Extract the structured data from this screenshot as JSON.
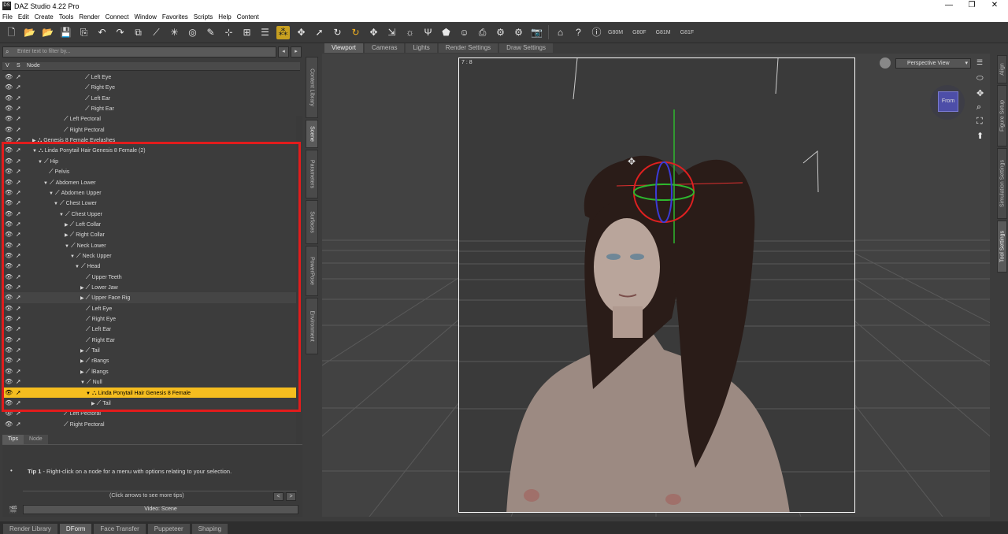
{
  "window": {
    "title": "DAZ Studio 4.22 Pro"
  },
  "menu": [
    "File",
    "Edit",
    "Create",
    "Tools",
    "Render",
    "Connect",
    "Window",
    "Favorites",
    "Scripts",
    "Help",
    "Content"
  ],
  "toolbar": {
    "text_buttons": [
      "G80M",
      "G80F",
      "G81M",
      "G81F"
    ]
  },
  "scene": {
    "filter_placeholder": "Enter text to filter by...",
    "columns": {
      "v": "V",
      "s": "S",
      "node": "Node"
    },
    "rows": [
      {
        "label": "Left Eye",
        "indent": 105,
        "expand": ""
      },
      {
        "label": "Right Eye",
        "indent": 105,
        "expand": ""
      },
      {
        "label": "Left Ear",
        "indent": 105,
        "expand": ""
      },
      {
        "label": "Right Ear",
        "indent": 105,
        "expand": ""
      },
      {
        "label": "Left Pectoral",
        "indent": 78,
        "expand": ""
      },
      {
        "label": "Right Pectoral",
        "indent": 78,
        "expand": ""
      },
      {
        "label": "Genesis 8 Female Eyelashes",
        "indent": 38,
        "expand": "▶",
        "figure": true
      },
      {
        "label": "Linda Ponytail Hair Genesis 8 Female (2)",
        "indent": 38,
        "expand": "▼",
        "figure": true
      },
      {
        "label": "Hip",
        "indent": 45,
        "expand": "▼"
      },
      {
        "label": "Pelvis",
        "indent": 59,
        "expand": ""
      },
      {
        "label": "Abdomen Lower",
        "indent": 52,
        "expand": "▼"
      },
      {
        "label": "Abdomen Upper",
        "indent": 59,
        "expand": "▼"
      },
      {
        "label": "Chest Lower",
        "indent": 65,
        "expand": "▼"
      },
      {
        "label": "Chest Upper",
        "indent": 72,
        "expand": "▼"
      },
      {
        "label": "Left Collar",
        "indent": 79,
        "expand": "▶"
      },
      {
        "label": "Right Collar",
        "indent": 79,
        "expand": "▶"
      },
      {
        "label": "Neck Lower",
        "indent": 79,
        "expand": "▼"
      },
      {
        "label": "Neck Upper",
        "indent": 86,
        "expand": "▼"
      },
      {
        "label": "Head",
        "indent": 92,
        "expand": "▼"
      },
      {
        "label": "Upper Teeth",
        "indent": 106,
        "expand": ""
      },
      {
        "label": "Lower Jaw",
        "indent": 99,
        "expand": "▶"
      },
      {
        "label": "Upper Face Rig",
        "indent": 99,
        "expand": "▶",
        "alt": true
      },
      {
        "label": "Left Eye",
        "indent": 106,
        "expand": ""
      },
      {
        "label": "Right Eye",
        "indent": 106,
        "expand": ""
      },
      {
        "label": "Left Ear",
        "indent": 106,
        "expand": ""
      },
      {
        "label": "Right Ear",
        "indent": 106,
        "expand": ""
      },
      {
        "label": "Tail",
        "indent": 99,
        "expand": "▶"
      },
      {
        "label": "rBangs",
        "indent": 99,
        "expand": "▶"
      },
      {
        "label": "lBangs",
        "indent": 99,
        "expand": "▶"
      },
      {
        "label": "Null",
        "indent": 99,
        "expand": "▼"
      },
      {
        "label": "Linda Ponytail Hair Genesis 8 Female",
        "indent": 106,
        "expand": "▼",
        "figure": true,
        "selected": true
      },
      {
        "label": "Tail",
        "indent": 113,
        "expand": "▶"
      },
      {
        "label": "Left Pectoral",
        "indent": 78,
        "expand": ""
      },
      {
        "label": "Right Pectoral",
        "indent": 78,
        "expand": ""
      }
    ]
  },
  "tips": {
    "tabs": [
      "Tips",
      "Node"
    ],
    "tip_bold": "Tip 1",
    "tip_text": " - Right-click on a node for a menu with options relating to your selection.",
    "nav_hint": "(Click arrows to see more tips)",
    "video_button": "Video: Scene"
  },
  "left_vtabs": [
    "Content Library",
    "Scene",
    "Parameters",
    "Surfaces",
    "PowerPose",
    "Environment"
  ],
  "viewport": {
    "tabs": [
      "Viewport",
      "Cameras",
      "Lights",
      "Render Settings",
      "Draw Settings"
    ],
    "aspect": "7 : 8",
    "view_selector": "Perspective View",
    "cube_label": "From"
  },
  "right_vtabs": [
    "Align",
    "Figure Setup",
    "Simulation Settings",
    "Tool Settings"
  ],
  "bottom_tabs": [
    "Render Library",
    "DForm",
    "Face Transfer",
    "Puppeteer",
    "Shaping"
  ]
}
